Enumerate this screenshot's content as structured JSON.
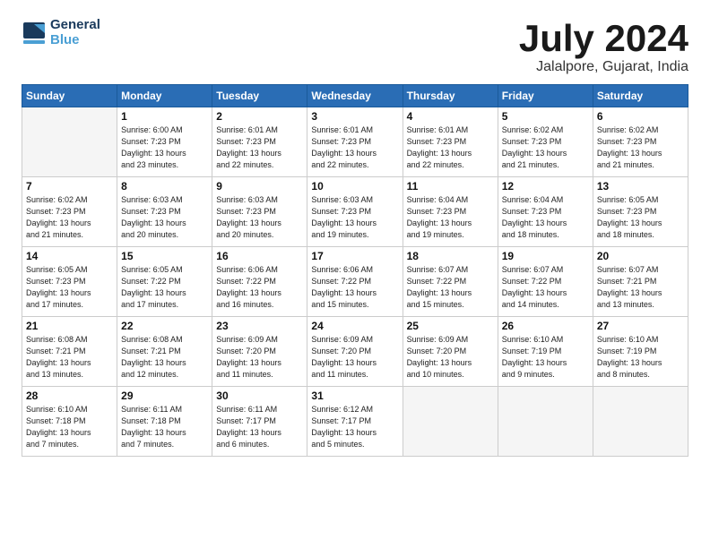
{
  "header": {
    "logo_line1": "General",
    "logo_line2": "Blue",
    "month": "July 2024",
    "location": "Jalalpore, Gujarat, India"
  },
  "weekdays": [
    "Sunday",
    "Monday",
    "Tuesday",
    "Wednesday",
    "Thursday",
    "Friday",
    "Saturday"
  ],
  "weeks": [
    [
      {
        "day": "",
        "info": ""
      },
      {
        "day": "1",
        "info": "Sunrise: 6:00 AM\nSunset: 7:23 PM\nDaylight: 13 hours\nand 23 minutes."
      },
      {
        "day": "2",
        "info": "Sunrise: 6:01 AM\nSunset: 7:23 PM\nDaylight: 13 hours\nand 22 minutes."
      },
      {
        "day": "3",
        "info": "Sunrise: 6:01 AM\nSunset: 7:23 PM\nDaylight: 13 hours\nand 22 minutes."
      },
      {
        "day": "4",
        "info": "Sunrise: 6:01 AM\nSunset: 7:23 PM\nDaylight: 13 hours\nand 22 minutes."
      },
      {
        "day": "5",
        "info": "Sunrise: 6:02 AM\nSunset: 7:23 PM\nDaylight: 13 hours\nand 21 minutes."
      },
      {
        "day": "6",
        "info": "Sunrise: 6:02 AM\nSunset: 7:23 PM\nDaylight: 13 hours\nand 21 minutes."
      }
    ],
    [
      {
        "day": "7",
        "info": "Sunrise: 6:02 AM\nSunset: 7:23 PM\nDaylight: 13 hours\nand 21 minutes."
      },
      {
        "day": "8",
        "info": "Sunrise: 6:03 AM\nSunset: 7:23 PM\nDaylight: 13 hours\nand 20 minutes."
      },
      {
        "day": "9",
        "info": "Sunrise: 6:03 AM\nSunset: 7:23 PM\nDaylight: 13 hours\nand 20 minutes."
      },
      {
        "day": "10",
        "info": "Sunrise: 6:03 AM\nSunset: 7:23 PM\nDaylight: 13 hours\nand 19 minutes."
      },
      {
        "day": "11",
        "info": "Sunrise: 6:04 AM\nSunset: 7:23 PM\nDaylight: 13 hours\nand 19 minutes."
      },
      {
        "day": "12",
        "info": "Sunrise: 6:04 AM\nSunset: 7:23 PM\nDaylight: 13 hours\nand 18 minutes."
      },
      {
        "day": "13",
        "info": "Sunrise: 6:05 AM\nSunset: 7:23 PM\nDaylight: 13 hours\nand 18 minutes."
      }
    ],
    [
      {
        "day": "14",
        "info": "Sunrise: 6:05 AM\nSunset: 7:23 PM\nDaylight: 13 hours\nand 17 minutes."
      },
      {
        "day": "15",
        "info": "Sunrise: 6:05 AM\nSunset: 7:22 PM\nDaylight: 13 hours\nand 17 minutes."
      },
      {
        "day": "16",
        "info": "Sunrise: 6:06 AM\nSunset: 7:22 PM\nDaylight: 13 hours\nand 16 minutes."
      },
      {
        "day": "17",
        "info": "Sunrise: 6:06 AM\nSunset: 7:22 PM\nDaylight: 13 hours\nand 15 minutes."
      },
      {
        "day": "18",
        "info": "Sunrise: 6:07 AM\nSunset: 7:22 PM\nDaylight: 13 hours\nand 15 minutes."
      },
      {
        "day": "19",
        "info": "Sunrise: 6:07 AM\nSunset: 7:22 PM\nDaylight: 13 hours\nand 14 minutes."
      },
      {
        "day": "20",
        "info": "Sunrise: 6:07 AM\nSunset: 7:21 PM\nDaylight: 13 hours\nand 13 minutes."
      }
    ],
    [
      {
        "day": "21",
        "info": "Sunrise: 6:08 AM\nSunset: 7:21 PM\nDaylight: 13 hours\nand 13 minutes."
      },
      {
        "day": "22",
        "info": "Sunrise: 6:08 AM\nSunset: 7:21 PM\nDaylight: 13 hours\nand 12 minutes."
      },
      {
        "day": "23",
        "info": "Sunrise: 6:09 AM\nSunset: 7:20 PM\nDaylight: 13 hours\nand 11 minutes."
      },
      {
        "day": "24",
        "info": "Sunrise: 6:09 AM\nSunset: 7:20 PM\nDaylight: 13 hours\nand 11 minutes."
      },
      {
        "day": "25",
        "info": "Sunrise: 6:09 AM\nSunset: 7:20 PM\nDaylight: 13 hours\nand 10 minutes."
      },
      {
        "day": "26",
        "info": "Sunrise: 6:10 AM\nSunset: 7:19 PM\nDaylight: 13 hours\nand 9 minutes."
      },
      {
        "day": "27",
        "info": "Sunrise: 6:10 AM\nSunset: 7:19 PM\nDaylight: 13 hours\nand 8 minutes."
      }
    ],
    [
      {
        "day": "28",
        "info": "Sunrise: 6:10 AM\nSunset: 7:18 PM\nDaylight: 13 hours\nand 7 minutes."
      },
      {
        "day": "29",
        "info": "Sunrise: 6:11 AM\nSunset: 7:18 PM\nDaylight: 13 hours\nand 7 minutes."
      },
      {
        "day": "30",
        "info": "Sunrise: 6:11 AM\nSunset: 7:17 PM\nDaylight: 13 hours\nand 6 minutes."
      },
      {
        "day": "31",
        "info": "Sunrise: 6:12 AM\nSunset: 7:17 PM\nDaylight: 13 hours\nand 5 minutes."
      },
      {
        "day": "",
        "info": ""
      },
      {
        "day": "",
        "info": ""
      },
      {
        "day": "",
        "info": ""
      }
    ]
  ]
}
